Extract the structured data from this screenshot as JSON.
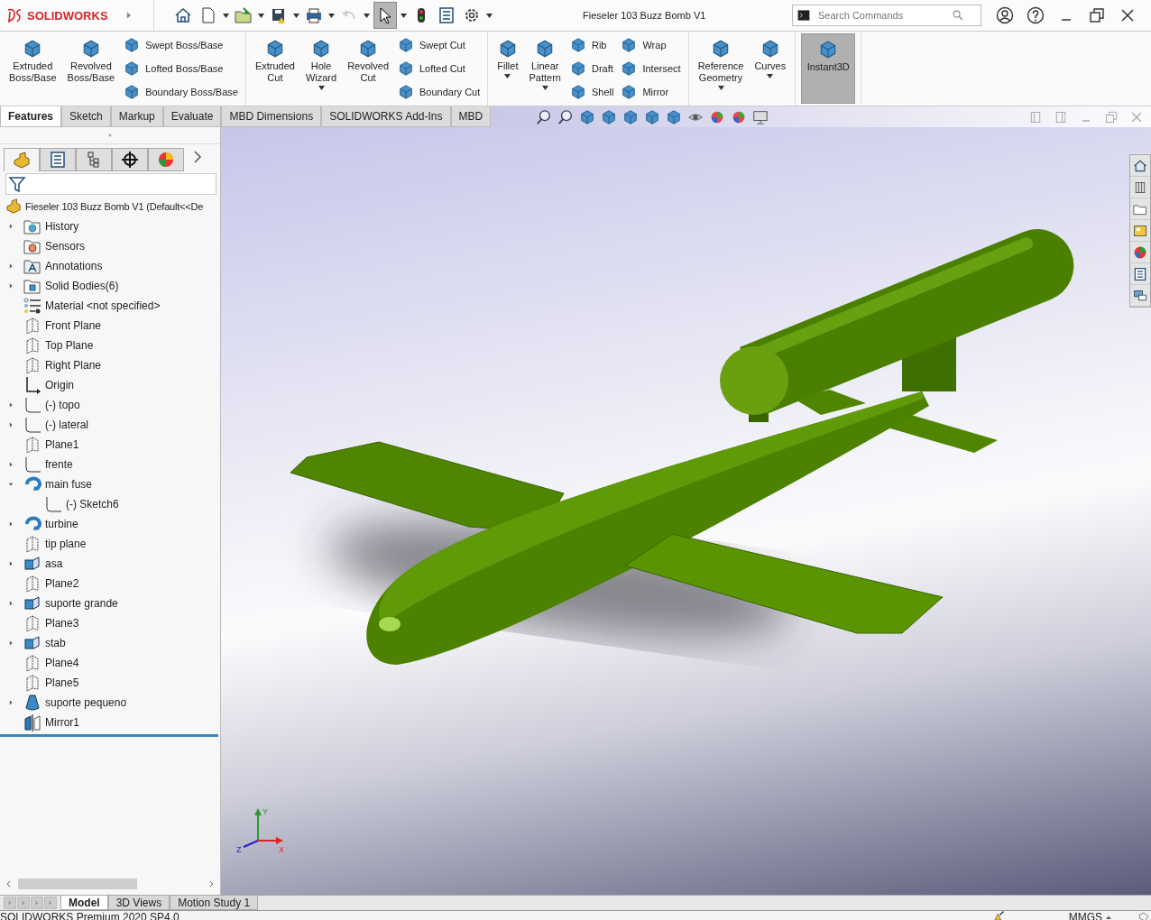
{
  "titlebar": {
    "brand": "SOLIDWORKS",
    "document_title": "Fieseler 103 Buzz Bomb V1",
    "search": {
      "placeholder": "Search Commands"
    },
    "select_tool": {
      "selected": true
    },
    "undo": {
      "disabled": true
    }
  },
  "ribbon": {
    "sections": [
      {
        "columns": [
          {
            "kind": "large",
            "label": "Extruded Boss/Base",
            "dropdown": false,
            "selected": false
          },
          {
            "kind": "large",
            "label": "Revolved Boss/Base",
            "dropdown": false,
            "selected": false
          },
          {
            "kind": "stack",
            "items": [
              "Swept Boss/Base",
              "Lofted Boss/Base",
              "Boundary Boss/Base"
            ]
          }
        ]
      },
      {
        "columns": [
          {
            "kind": "large",
            "label": "Extruded Cut",
            "dropdown": false,
            "selected": false
          },
          {
            "kind": "large",
            "label": "Hole Wizard",
            "dropdown": true,
            "selected": false
          },
          {
            "kind": "large",
            "label": "Revolved Cut",
            "dropdown": false,
            "selected": false
          },
          {
            "kind": "stack",
            "items": [
              "Swept Cut",
              "Lofted Cut",
              "Boundary Cut"
            ]
          }
        ]
      },
      {
        "columns": [
          {
            "kind": "large",
            "label": "Fillet",
            "dropdown": true,
            "selected": false
          },
          {
            "kind": "large",
            "label": "Linear Pattern",
            "dropdown": true,
            "selected": false
          },
          {
            "kind": "stack",
            "items": [
              "Rib",
              "Draft",
              "Shell"
            ]
          },
          {
            "kind": "stack",
            "items": [
              "Wrap",
              "Intersect",
              "Mirror"
            ]
          }
        ]
      },
      {
        "columns": [
          {
            "kind": "large",
            "label": "Reference Geometry",
            "dropdown": true,
            "selected": false
          },
          {
            "kind": "large",
            "label": "Curves",
            "dropdown": true,
            "selected": false
          }
        ]
      },
      {
        "columns": [
          {
            "kind": "large",
            "label": "Instant3D",
            "dropdown": false,
            "selected": true
          }
        ]
      }
    ]
  },
  "command_tabs": [
    {
      "label": "Features",
      "selected": true
    },
    {
      "label": "Sketch",
      "selected": false
    },
    {
      "label": "Markup",
      "selected": false
    },
    {
      "label": "Evaluate",
      "selected": false
    },
    {
      "label": "MBD Dimensions",
      "selected": false
    },
    {
      "label": "SOLIDWORKS Add-Ins",
      "selected": false
    },
    {
      "label": "MBD",
      "selected": false
    }
  ],
  "panel_tabs": [
    {
      "selected": true
    },
    {
      "selected": false
    },
    {
      "selected": false
    },
    {
      "selected": false
    },
    {
      "selected": false
    }
  ],
  "feature_tree": {
    "root": "Fieseler 103 Buzz Bomb V1  (Default<<De",
    "items": [
      {
        "label": "History",
        "kind": "history",
        "expanded": false
      },
      {
        "label": "Sensors",
        "kind": "sensors"
      },
      {
        "label": "Annotations",
        "kind": "annotations",
        "expanded": false
      },
      {
        "label": "Solid Bodies(6)",
        "kind": "bodies",
        "expanded": false
      },
      {
        "label": "Material <not specified>",
        "kind": "material"
      },
      {
        "label": "Front Plane",
        "kind": "plane"
      },
      {
        "label": "Top Plane",
        "kind": "plane"
      },
      {
        "label": "Right Plane",
        "kind": "plane"
      },
      {
        "label": "Origin",
        "kind": "origin"
      },
      {
        "label": "(-) topo",
        "kind": "sketch",
        "expanded": false
      },
      {
        "label": "(-) lateral",
        "kind": "sketch",
        "expanded": false
      },
      {
        "label": "Plane1",
        "kind": "plane"
      },
      {
        "label": "frente",
        "kind": "sketch",
        "expanded": false
      },
      {
        "label": "main fuse",
        "kind": "revolve",
        "expanded": true,
        "children": [
          {
            "label": "(-) Sketch6",
            "kind": "sketch"
          }
        ]
      },
      {
        "label": "turbine",
        "kind": "revolve",
        "expanded": false
      },
      {
        "label": "tip plane",
        "kind": "plane"
      },
      {
        "label": "asa",
        "kind": "extrude",
        "expanded": false
      },
      {
        "label": "Plane2",
        "kind": "plane"
      },
      {
        "label": "suporte grande",
        "kind": "extrude",
        "expanded": false
      },
      {
        "label": "Plane3",
        "kind": "plane"
      },
      {
        "label": "stab",
        "kind": "extrude",
        "expanded": false
      },
      {
        "label": "Plane4",
        "kind": "plane"
      },
      {
        "label": "Plane5",
        "kind": "plane"
      },
      {
        "label": "suporte pequeno",
        "kind": "loft",
        "expanded": false
      },
      {
        "label": "Mirror1",
        "kind": "mirror"
      }
    ]
  },
  "triad": {
    "y": "Y",
    "z": "Z",
    "x": "X"
  },
  "bottom_tabs": [
    {
      "label": "Model",
      "selected": true
    },
    {
      "label": "3D Views",
      "selected": false
    },
    {
      "label": "Motion Study 1",
      "selected": false
    }
  ],
  "status_bar": {
    "product": "SOLIDWORKS Premium 2020 SP4.0",
    "units": "MMGS"
  }
}
